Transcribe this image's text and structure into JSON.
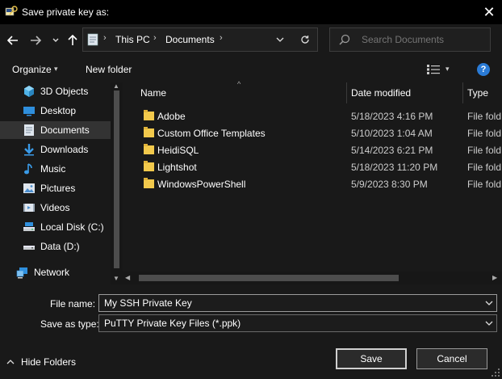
{
  "window": {
    "title": "Save private key as:",
    "icon": "putty-key-icon",
    "close_glyph": "✕"
  },
  "nav": {
    "back_glyph": "←",
    "forward_glyph": "→",
    "recent_glyph": "⌄",
    "up_glyph": "↑",
    "breadcrumb": [
      "This PC",
      "Documents"
    ],
    "separator": "›",
    "refresh_glyph": "↻",
    "search_placeholder": "Search Documents"
  },
  "toolbar": {
    "organize_label": "Organize",
    "newfolder_label": "New folder",
    "help_label": "?",
    "chevron": "▾"
  },
  "sidebar": {
    "items": [
      {
        "label": "3D Objects",
        "icon": "3d-objects-icon"
      },
      {
        "label": "Desktop",
        "icon": "desktop-icon"
      },
      {
        "label": "Documents",
        "icon": "documents-icon"
      },
      {
        "label": "Downloads",
        "icon": "downloads-icon"
      },
      {
        "label": "Music",
        "icon": "music-icon"
      },
      {
        "label": "Pictures",
        "icon": "pictures-icon"
      },
      {
        "label": "Videos",
        "icon": "videos-icon"
      },
      {
        "label": "Local Disk (C:)",
        "icon": "drive-icon"
      },
      {
        "label": "Data (D:)",
        "icon": "drive-icon"
      },
      {
        "label": "Network",
        "icon": "network-icon"
      }
    ],
    "selected": "Documents"
  },
  "filelist": {
    "columns": [
      "Name",
      "Date modified",
      "Type"
    ],
    "sort_glyph": "^",
    "rows": [
      {
        "name": "Adobe",
        "date": "5/18/2023 4:16 PM",
        "type": "File fold"
      },
      {
        "name": "Custom Office Templates",
        "date": "5/10/2023 1:04 AM",
        "type": "File fold"
      },
      {
        "name": "HeidiSQL",
        "date": "5/14/2023 6:21 PM",
        "type": "File fold"
      },
      {
        "name": "Lightshot",
        "date": "5/18/2023 11:20 PM",
        "type": "File fold"
      },
      {
        "name": "WindowsPowerShell",
        "date": "5/9/2023 8:30 PM",
        "type": "File fold"
      }
    ]
  },
  "form": {
    "filename_label": "File name:",
    "filename_value": "My SSH Private Key",
    "filetype_label": "Save as type:",
    "filetype_value": "PuTTY Private Key Files (*.ppk)"
  },
  "footer": {
    "hide_folders_label": "Hide Folders",
    "save_label": "Save",
    "cancel_label": "Cancel"
  },
  "scroll": {
    "up": "▲",
    "down": "▼",
    "left": "◀",
    "right": "▶"
  },
  "colors": {
    "background": "#191919",
    "titlebar": "#000000",
    "selection": "#333333",
    "folder": "#f2c94c",
    "accent": "#2a7bd6"
  }
}
